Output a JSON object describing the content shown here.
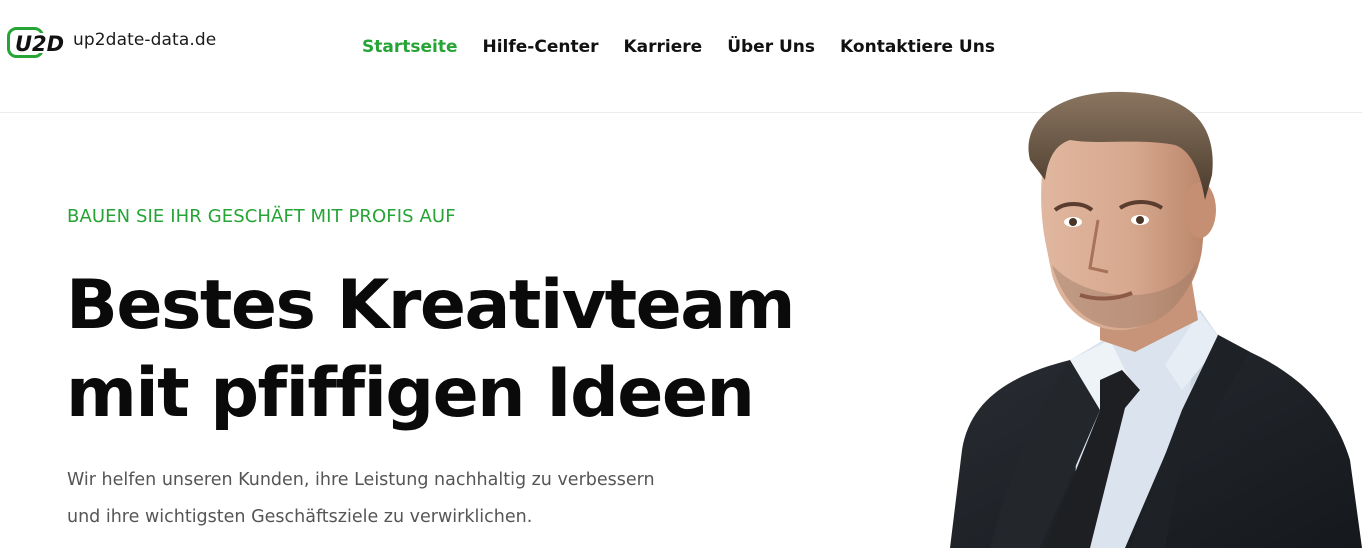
{
  "brand": {
    "name": "up2date-data.de",
    "mark_text": "U2D",
    "accent_color": "#27a436"
  },
  "nav": {
    "items": [
      {
        "label": "Startseite",
        "active": true
      },
      {
        "label": "Hilfe-Center",
        "active": false
      },
      {
        "label": "Karriere",
        "active": false
      },
      {
        "label": "Über Uns",
        "active": false
      },
      {
        "label": "Kontaktiere Uns",
        "active": false
      }
    ]
  },
  "hero": {
    "eyebrow": "BAUEN SIE IHR GESCHÄFT MIT PROFIS AUF",
    "headline_line1": "Bestes Kreativteam",
    "headline_line2": "mit pfiffigen Ideen",
    "lead_line1": "Wir helfen unseren Kunden, ihre Leistung nachhaltig zu verbessern",
    "lead_line2": "und ihre wichtigsten Geschäftsziele zu verwirklichen.",
    "image": "businessman-portrait"
  }
}
